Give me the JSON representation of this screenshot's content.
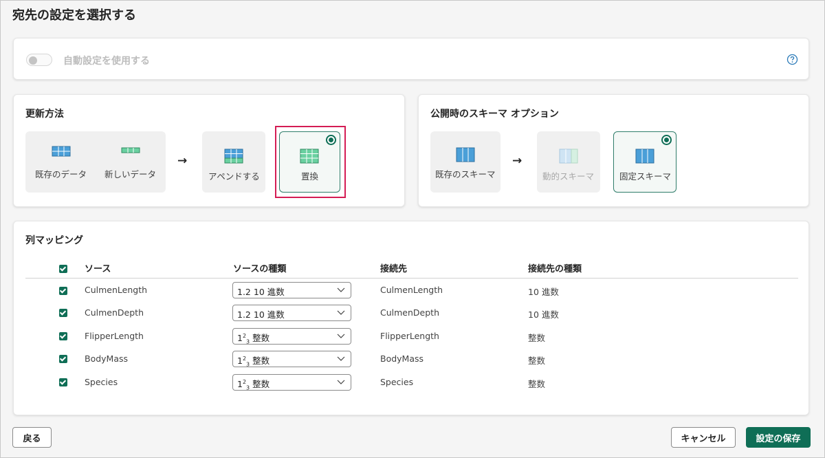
{
  "page": {
    "title": "宛先の設定を選択する"
  },
  "auto_setting": {
    "label": "自動設定を使用する",
    "enabled": false
  },
  "update_method": {
    "title": "更新方法",
    "tiles": [
      {
        "label": "既存のデータ",
        "icon": "table-grid-icon"
      },
      {
        "label": "新しいデータ",
        "icon": "table-row-icon"
      },
      {
        "label": "アペンドする",
        "icon": "append-table-icon"
      },
      {
        "label": "置換",
        "icon": "replace-table-icon",
        "selected": true
      }
    ],
    "arrow": "→"
  },
  "schema_options": {
    "title": "公開時のスキーマ オプション",
    "tiles": [
      {
        "label": "既存のスキーマ",
        "icon": "schema-columns-icon"
      },
      {
        "label": "動的スキーマ",
        "icon": "dynamic-schema-icon",
        "disabled": true
      },
      {
        "label": "固定スキーマ",
        "icon": "fixed-schema-icon",
        "selected": true
      }
    ],
    "arrow": "→"
  },
  "mapping": {
    "title": "列マッピング",
    "headers": {
      "source": "ソース",
      "source_type": "ソースの種類",
      "dest": "接続先",
      "dest_type": "接続先の種類"
    },
    "rows": [
      {
        "source": "CulmenLength",
        "type_prefix": "1.2",
        "type_label": "10 進数",
        "dest": "CulmenLength",
        "dest_type": "10 進数",
        "checked": true
      },
      {
        "source": "CulmenDepth",
        "type_prefix": "1.2",
        "type_label": "10 進数",
        "dest": "CulmenDepth",
        "dest_type": "10 進数",
        "checked": true
      },
      {
        "source": "FlipperLength",
        "type_prefix": "123",
        "type_label": "整数",
        "dest": "FlipperLength",
        "dest_type": "整数",
        "checked": true
      },
      {
        "source": "BodyMass",
        "type_prefix": "123",
        "type_label": "整数",
        "dest": "BodyMass",
        "dest_type": "整数",
        "checked": true
      },
      {
        "source": "Species",
        "type_prefix": "123",
        "type_label": "整数",
        "dest": "Species",
        "dest_type": "整数",
        "checked": true
      }
    ]
  },
  "footer": {
    "back": "戻る",
    "cancel": "キャンセル",
    "save": "設定の保存"
  },
  "colors": {
    "accent": "#0f6e56",
    "highlight": "#d41c54",
    "help": "#2a7ab8"
  }
}
